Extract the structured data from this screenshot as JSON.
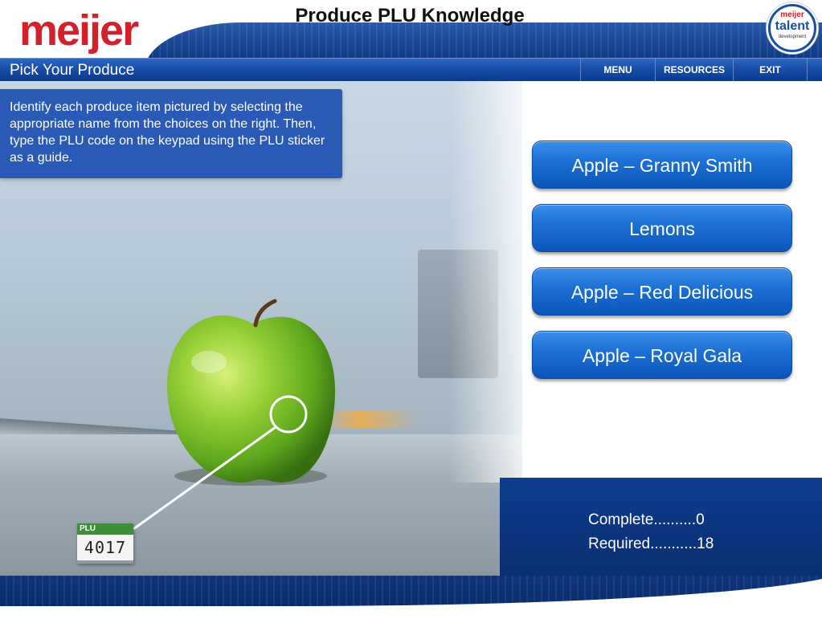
{
  "header": {
    "logo_text": "meijer",
    "title": "Produce PLU Knowledge",
    "badge": {
      "line1": "meijer",
      "line2": "talent",
      "line3": "development"
    }
  },
  "nav": {
    "section_title": "Pick Your Produce",
    "menu_label": "MENU",
    "resources_label": "RESOURCES",
    "exit_label": "EXIT"
  },
  "instructions": "Identify each produce item pictured by selecting the appropriate name from the choices on the right. Then, type the PLU code on the keypad using the PLU sticker as a guide.",
  "plu_sticker": {
    "label": "PLU",
    "code": "4017"
  },
  "choices": [
    {
      "label": "Apple – Granny Smith"
    },
    {
      "label": "Lemons"
    },
    {
      "label": "Apple – Red Delicious"
    },
    {
      "label": "Apple – Royal Gala"
    }
  ],
  "progress": {
    "complete_text": "Complete..........0",
    "required_text": "Required...........18"
  },
  "colors": {
    "brand_red": "#d3202a",
    "brand_blue": "#1b4fa0",
    "button_blue": "#1b6fd4",
    "panel_navy": "#0a2f72"
  },
  "icons": [
    "apple-image",
    "plu-pointer-circle"
  ]
}
